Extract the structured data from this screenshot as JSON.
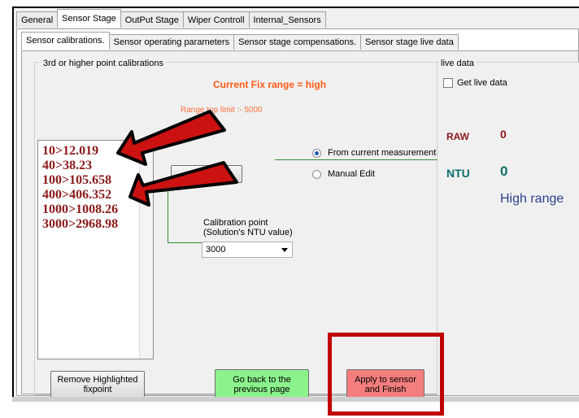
{
  "tabs": [
    "General",
    "Sensor Stage",
    "OutPut Stage",
    "Wiper Controll",
    "Internal_Sensors"
  ],
  "active_tab": "Sensor Stage",
  "subtabs": [
    "Sensor calibrations.",
    "Sensor operating parameters",
    "Sensor stage compensations.",
    "Sensor stage live data"
  ],
  "active_subtab": "Sensor calibrations.",
  "calibration_group": {
    "legend": "3rd or higher point calibrations",
    "current_range": "Current  Fix range = high",
    "range_top_limit": "Range top limit :-   5000",
    "fixpoints": [
      "10>12.019",
      "40>38.23",
      "100>105.658",
      "400>406.352",
      "1000>1008.26",
      "3000>2968.98"
    ],
    "hidden_button_label": "",
    "radio_current": "From current measurement",
    "radio_manual": "Manual Edit",
    "calibration_point_label_1": "Calibration point",
    "calibration_point_label_2": "(Solution's NTU value)",
    "calibration_point_value": "3000",
    "remove_button": [
      "Remove Highlighted",
      "fixpoint"
    ],
    "back_button": [
      "Go back to the",
      "previous page"
    ],
    "apply_button": [
      "Apply to sensor",
      "and Finish"
    ]
  },
  "live_data": {
    "legend": "live data",
    "checkbox_label": "Get live data",
    "raw_label": "RAW",
    "raw_value": "0",
    "ntu_label": "NTU",
    "ntu_value": "0",
    "range_text": "High range"
  },
  "colors": {
    "annotation_red": "#c00000",
    "fixpoint_text": "#8b1a1a",
    "current_range": "#ff5a14",
    "apply_button": "#f47e7e",
    "back_button": "#8cf28c"
  }
}
